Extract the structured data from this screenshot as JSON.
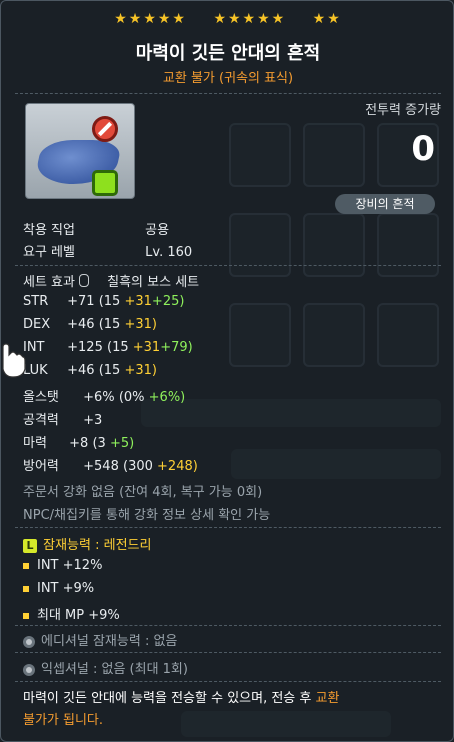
{
  "tooltip": {
    "stars": {
      "group1": "★★★★★",
      "group2": "★★★★★",
      "group3": "★★"
    },
    "item_name": "마력이 깃든 안대의 흔적",
    "tradeability": "교환 불가 (귀속의 표식)",
    "combat_power_label": "전투력 증가량",
    "combat_power_value": "0",
    "trace_badge": "장비의 흔적",
    "job": {
      "label": "착용 직업",
      "value": "공용"
    },
    "level": {
      "label": "요구 레벨",
      "value": "Lv. 160"
    },
    "set": {
      "label": "세트 효과",
      "value": "칠흑의 보스 세트"
    },
    "stats": [
      {
        "label": "STR",
        "total": "+71",
        "base": "(15",
        "star": "+31",
        "bonus": "+25)"
      },
      {
        "label": "DEX",
        "total": "+46",
        "base": "(15",
        "star": "+31)",
        "bonus": ""
      },
      {
        "label": "INT",
        "total": "+125",
        "base": "(15",
        "star": "+31",
        "bonus": "+79)"
      },
      {
        "label": "LUK",
        "total": "+46",
        "base": "(15",
        "star": "+31)",
        "bonus": ""
      },
      {
        "label": "올스탯",
        "total": "+6%",
        "base": "(0%",
        "star": "",
        "bonus": "+6%)"
      },
      {
        "label": "공격력",
        "total": "+3",
        "base": "",
        "star": "",
        "bonus": ""
      },
      {
        "label": "마력",
        "total": "+8",
        "base": "(3",
        "star": "",
        "bonus": "+5)"
      },
      {
        "label": "방어력",
        "total": "+548",
        "base": "(300",
        "star": "+248)",
        "bonus": ""
      }
    ],
    "scroll_info": "주문서 강화 없음 (잔여 4회, 복구 가능 0회)",
    "npc_info": "NPC/채집키를 통해 강화 정보 상세 확인 가능",
    "potential": {
      "badge": "L",
      "title": "잠재능력 : 레전드리",
      "lines": [
        "INT +12%",
        "INT +9%",
        "최대 MP +9%"
      ]
    },
    "additional_potential": "에디셔널 잠재능력 : 없음",
    "exceptional": "익셉셔널 : 없음 (최대 1회)",
    "transfer_note_line1_a": "마력이 깃든 안대에 능력을 전승할 수 있으며, 전승 후 ",
    "transfer_note_line1_b": "교환",
    "transfer_note_line2": "불가가 됩니다."
  },
  "colors": {
    "star": "#f6c327",
    "orange": "#f59c30",
    "yellow": "#ffd035",
    "green": "#8ff15c"
  }
}
